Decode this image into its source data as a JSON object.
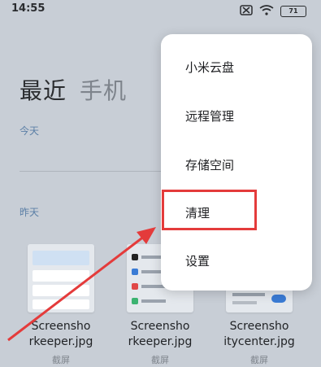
{
  "status": {
    "time": "14:55",
    "battery": "71"
  },
  "tabs": {
    "recent": "最近",
    "phone": "手机"
  },
  "sections": {
    "today": "今天",
    "yesterday": "昨天"
  },
  "files": [
    {
      "name_line1": "Screensho",
      "name_line2": "rkeeper.jpg",
      "category": "截屏"
    },
    {
      "name_line1": "Screensho",
      "name_line2": "rkeeper.jpg",
      "category": "截屏"
    },
    {
      "name_line1": "Screensho",
      "name_line2": "itycenter.jpg",
      "category": "截屏"
    }
  ],
  "menu": {
    "items": [
      "小米云盘",
      "远程管理",
      "存储空间",
      "清理",
      "设置"
    ]
  },
  "colors": {
    "highlight": "#e43b3b",
    "arrow": "#e43b3b"
  },
  "icons": [
    "sim-off-icon",
    "wifi-icon",
    "battery-icon"
  ]
}
